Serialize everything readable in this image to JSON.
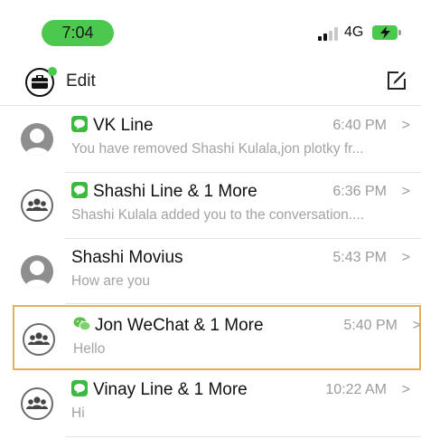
{
  "status_bar": {
    "time": "7:04",
    "network": "4G",
    "colors": {
      "pill": "#4cc84f",
      "battery": "#4cc84f"
    }
  },
  "header": {
    "edit_label": "Edit",
    "icons": {
      "left": "briefcase-icon",
      "right": "compose-icon"
    }
  },
  "conversations": [
    {
      "title": "VK Line",
      "app": "line-icon",
      "time": "6:40 PM",
      "preview": "You have removed Shashi Kulala,jon plotky fr...",
      "avatar": "person-avatar-icon"
    },
    {
      "title": "Shashi Line & 1 More",
      "app": "line-icon",
      "time": "6:36 PM",
      "preview": "Shashi Kulala added you to the conversation....",
      "avatar": "group-avatar-icon"
    },
    {
      "title": "Shashi Movius",
      "app": "",
      "time": "5:43 PM",
      "preview": "How are you",
      "avatar": "person-avatar-icon"
    },
    {
      "title": "Jon WeChat & 1 More",
      "app": "wechat-icon",
      "time": "5:40 PM",
      "preview": "Hello",
      "avatar": "group-avatar-icon",
      "selected": true
    },
    {
      "title": "Vinay Line & 1 More",
      "app": "line-icon",
      "time": "10:22 AM",
      "preview": "Hi",
      "avatar": "group-avatar-icon"
    }
  ],
  "chevron": ">"
}
